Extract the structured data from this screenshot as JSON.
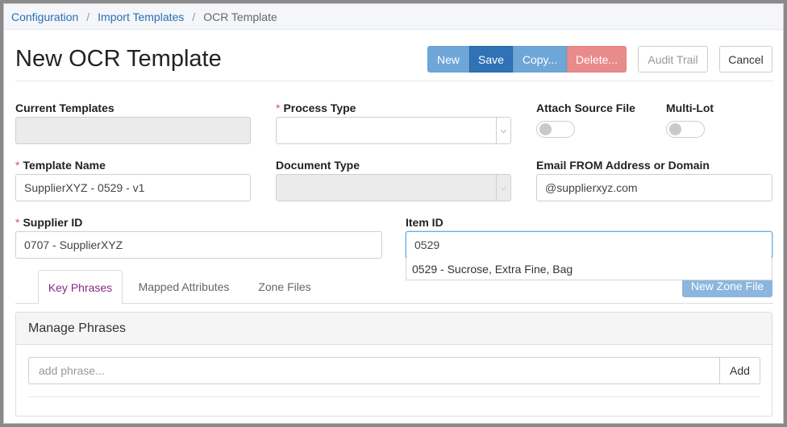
{
  "breadcrumb": {
    "items": [
      "Configuration",
      "Import Templates"
    ],
    "current": "OCR Template"
  },
  "header": {
    "title": "New OCR Template",
    "buttons": {
      "new": "New",
      "save": "Save",
      "copy": "Copy...",
      "delete": "Delete...",
      "audit_trail": "Audit Trail",
      "cancel": "Cancel"
    }
  },
  "form": {
    "current_templates": {
      "label": "Current Templates",
      "value": ""
    },
    "process_type": {
      "label": "Process Type",
      "required": "*",
      "value": ""
    },
    "attach_source_file": {
      "label": "Attach Source File",
      "state": "off"
    },
    "multi_lot": {
      "label": "Multi-Lot",
      "state": "off"
    },
    "template_name": {
      "label": "Template Name",
      "required": "*",
      "value": "SupplierXYZ - 0529 - v1"
    },
    "document_type": {
      "label": "Document Type",
      "value": ""
    },
    "email_from": {
      "label": "Email FROM Address or Domain",
      "value": "@supplierxyz.com"
    },
    "supplier_id": {
      "label": "Supplier ID",
      "required": "*",
      "value": "0707 - SupplierXYZ"
    },
    "item_id": {
      "label": "Item ID",
      "value": "0529",
      "suggestion": "0529 - Sucrose, Extra Fine, Bag"
    }
  },
  "tabs": [
    "Key Phrases",
    "Mapped Attributes",
    "Zone Files"
  ],
  "new_zone_file": "New Zone File",
  "panel": {
    "title": "Manage Phrases",
    "placeholder": "add phrase...",
    "add": "Add"
  },
  "colors": {
    "primary": "#2f72b5",
    "primary_light": "#6ea6d8",
    "danger_light": "#e98b8b",
    "active_tab": "#8b2a86",
    "link": "#2a6fb0"
  }
}
